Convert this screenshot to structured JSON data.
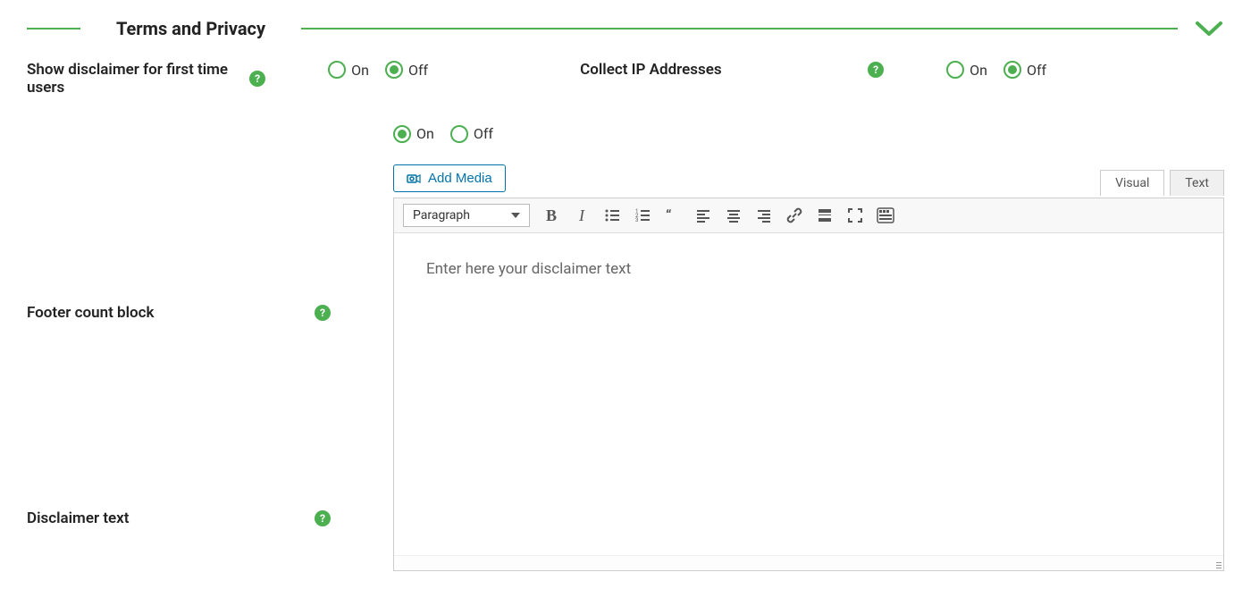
{
  "section": {
    "title": "Terms and Privacy"
  },
  "radio": {
    "on": "On",
    "off": "Off"
  },
  "fields": {
    "show_disclaimer": {
      "label": "Show disclaimer for first time users",
      "value": "off"
    },
    "collect_ip": {
      "label": "Collect IP Addresses",
      "value": "off"
    },
    "footer_count": {
      "label": "Footer count block",
      "value": "on"
    },
    "disclaimer_text": {
      "label": "Disclaimer text"
    }
  },
  "editor": {
    "add_media": "Add Media",
    "tabs": {
      "visual": "Visual",
      "text": "Text",
      "active": "visual"
    },
    "format": "Paragraph",
    "placeholder": "Enter here your disclaimer text"
  },
  "help_glyph": "?"
}
